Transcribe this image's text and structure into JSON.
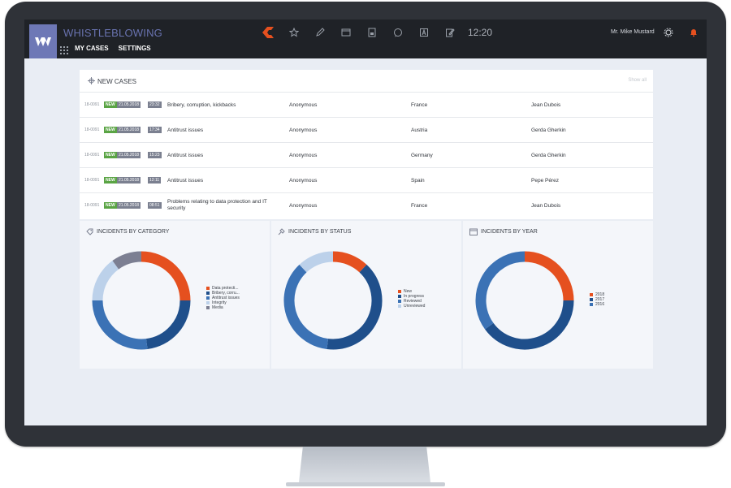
{
  "app": {
    "title": "WHISTLEBLOWING",
    "clock": "12:20",
    "user": "Mr. Mike Mustard"
  },
  "menu": {
    "my_cases": "MY CASES",
    "settings": "SETTINGS"
  },
  "new_cases": {
    "title": "NEW CASES",
    "show_all": "Show all",
    "rows": [
      {
        "id": "18-0091",
        "status": "NEW",
        "date": "21.05.2018",
        "time": "23:32",
        "subject": "Bribery, corruption, kickbacks",
        "reporter": "Anonymous",
        "country": "France",
        "handler": "Jean Dubois"
      },
      {
        "id": "18-0091",
        "status": "NEW",
        "date": "21.05.2018",
        "time": "17:34",
        "subject": "Antitrust issues",
        "reporter": "Anonymous",
        "country": "Austria",
        "handler": "Gerda Gherkin"
      },
      {
        "id": "18-0091",
        "status": "NEW",
        "date": "21.05.2018",
        "time": "15:23",
        "subject": "Antitrust issues",
        "reporter": "Anonymous",
        "country": "Germany",
        "handler": "Gerda Gherkin"
      },
      {
        "id": "18-0091",
        "status": "NEW",
        "date": "21.05.2018",
        "time": "12:11",
        "subject": "Antitrust issues",
        "reporter": "Anonymous",
        "country": "Spain",
        "handler": "Pepe Pérez"
      },
      {
        "id": "18-0091",
        "status": "NEW",
        "date": "21.05.2018",
        "time": "08:51",
        "subject": "Problems relating to data protection and IT security",
        "reporter": "Anonymous",
        "country": "France",
        "handler": "Jean Dubois"
      }
    ]
  },
  "colors": {
    "accent": "#6e78b6",
    "new_badge": "#5aa444",
    "topbar": "#1f2227"
  },
  "chart_data": [
    {
      "type": "pie",
      "title": "INCIDENTS BY CATEGORY",
      "categories": [
        "Data protecti...",
        "Bribery, corru...",
        "Antitrust issues",
        "Integrity",
        "Media"
      ],
      "values": [
        25,
        23,
        27,
        15,
        10
      ],
      "colors": [
        "#e5501f",
        "#1f4f8b",
        "#3b72b5",
        "#bcd1ea",
        "#7c7f92"
      ],
      "legend": "right"
    },
    {
      "type": "pie",
      "title": "INCIDENTS BY STATUS",
      "categories": [
        "New",
        "In progress",
        "Reviewed",
        "Unreviewed"
      ],
      "values": [
        12,
        40,
        36,
        12
      ],
      "colors": [
        "#e5501f",
        "#1f4f8b",
        "#3b72b5",
        "#bcd1ea"
      ],
      "legend": "right"
    },
    {
      "type": "pie",
      "title": "INCIDENTS BY YEAR",
      "categories": [
        "2018",
        "2017",
        "2016"
      ],
      "values": [
        25,
        40,
        35
      ],
      "colors": [
        "#e5501f",
        "#1f4f8b",
        "#3b72b5"
      ],
      "legend": "right"
    }
  ]
}
